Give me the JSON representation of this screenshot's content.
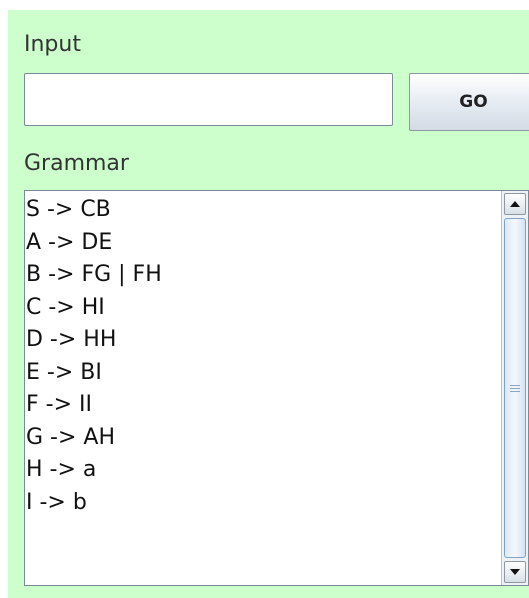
{
  "input_section": {
    "label": "Input",
    "value": "",
    "go_label": "GO"
  },
  "grammar_section": {
    "label": "Grammar",
    "lines": [
      "S -> CB",
      "A -> DE",
      "B -> FG | FH",
      "C -> HI",
      "D -> HH",
      "E -> BI",
      "F -> II",
      "G -> AH",
      "H -> a",
      "I -> b"
    ]
  },
  "colors": {
    "panel_background": "#ccffcc",
    "field_background": "#ffffff"
  },
  "icons": {
    "scroll_up": "up-arrow-icon",
    "scroll_down": "down-arrow-icon",
    "thumb_grip": "grip-icon"
  }
}
